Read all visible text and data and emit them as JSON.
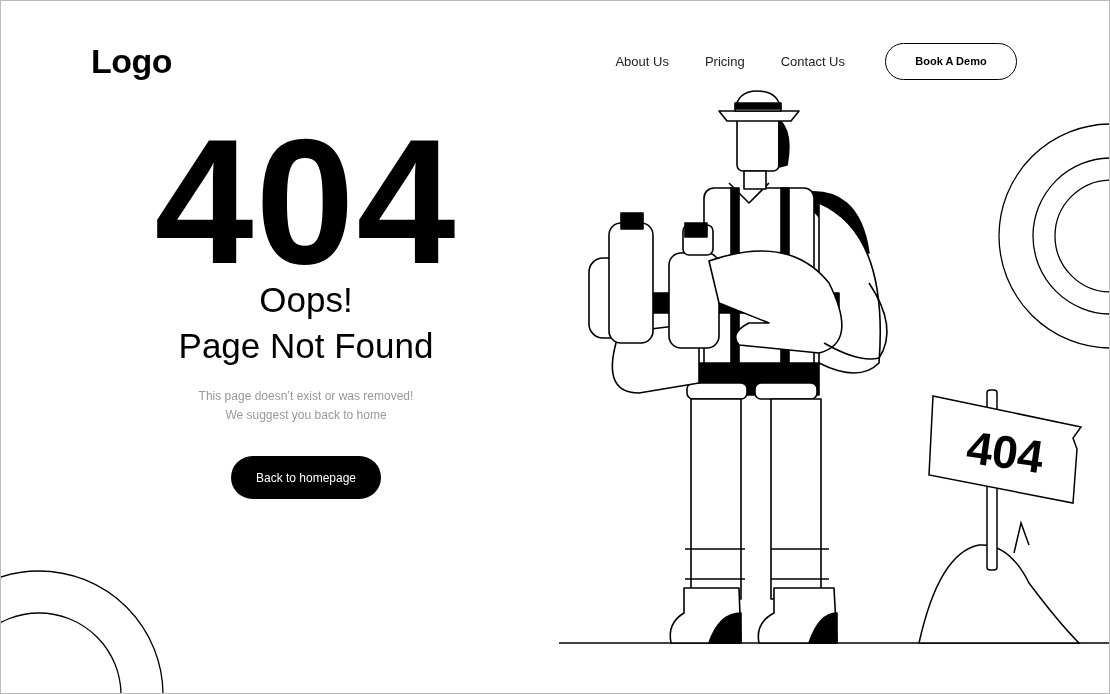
{
  "header": {
    "logo": "Logo",
    "nav": [
      "About Us",
      "Pricing",
      "Contact Us"
    ],
    "cta": "Book A Demo"
  },
  "error": {
    "code": "404",
    "title_lines": [
      "Oops!",
      "Page Not Found"
    ],
    "message_lines": [
      "This page doesn’t exist or was removed!",
      "We suggest you back to home"
    ],
    "button": "Back to homepage"
  },
  "illustration": {
    "sign_text": "404"
  }
}
